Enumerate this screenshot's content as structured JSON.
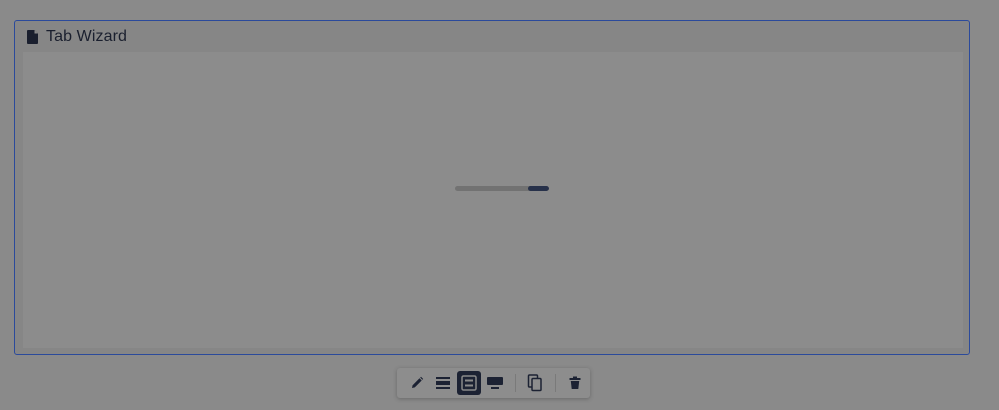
{
  "block": {
    "title": "Tab Wizard",
    "title_icon": "document-icon",
    "loading_progress": 0.22
  },
  "toolbar": {
    "buttons": [
      {
        "name": "edit-button",
        "icon": "pencil-icon"
      },
      {
        "name": "layout-compact-button",
        "icon": "rows-icon"
      },
      {
        "name": "layout-boxed-button",
        "icon": "boxed-rows-icon",
        "active": true
      },
      {
        "name": "layout-full-button",
        "icon": "monitor-icon"
      },
      {
        "name": "duplicate-button",
        "icon": "copy-icon"
      },
      {
        "name": "delete-button",
        "icon": "trash-icon"
      }
    ]
  },
  "colors": {
    "accent_border": "#2b4a9b",
    "active_button": "#1c2233"
  }
}
